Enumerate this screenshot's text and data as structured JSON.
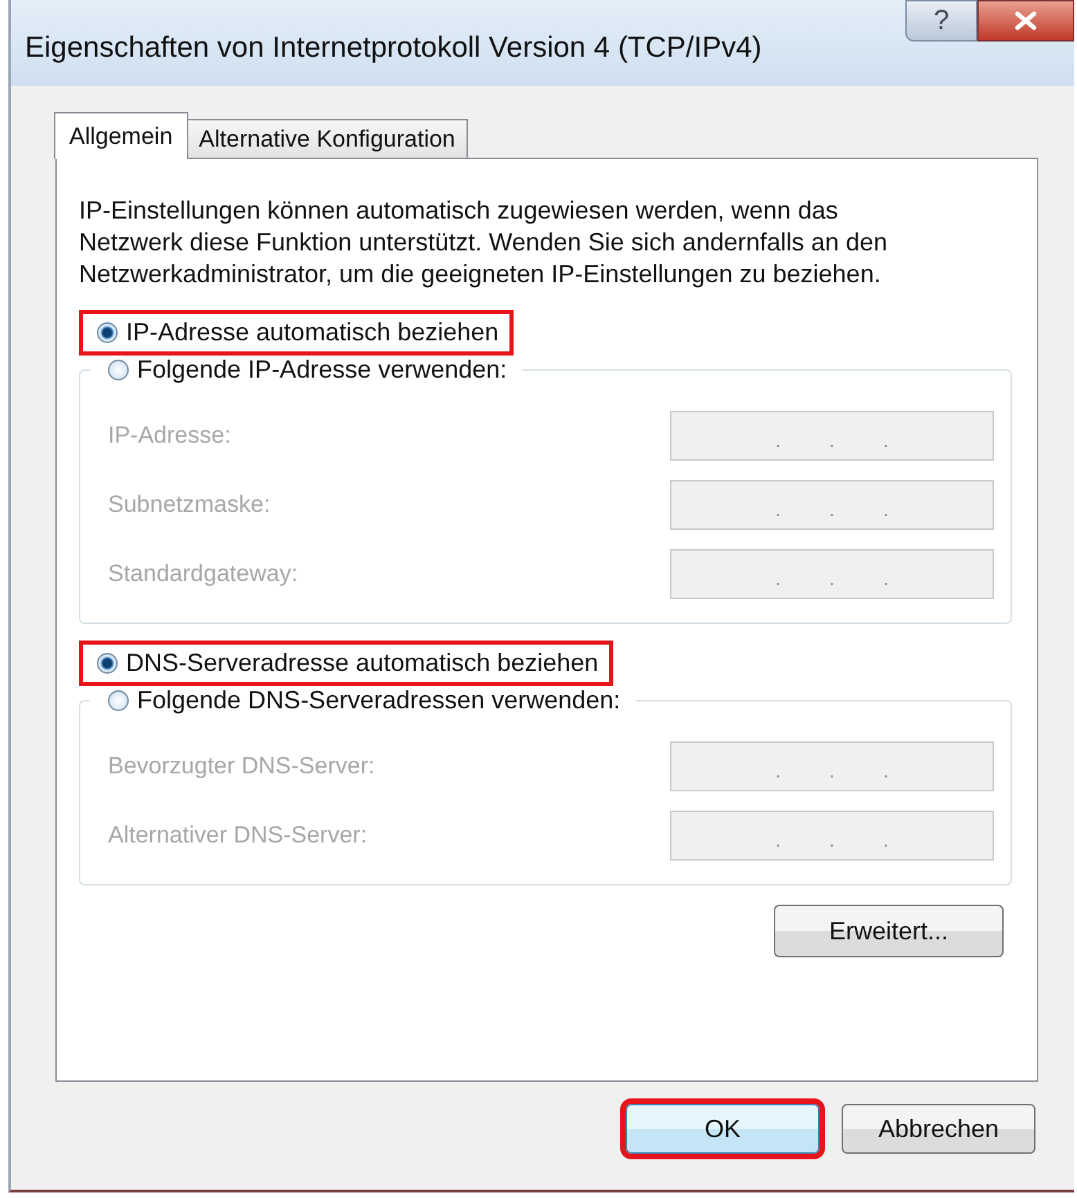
{
  "window": {
    "title": "Eigenschaften von Internetprotokoll Version 4 (TCP/IPv4)",
    "help_label": "?"
  },
  "tabs": [
    {
      "label": "Allgemein",
      "selected": true
    },
    {
      "label": "Alternative Konfiguration",
      "selected": false
    }
  ],
  "description": "IP-Einstellungen können automatisch zugewiesen werden, wenn das Netzwerk diese Funktion unterstützt. Wenden Sie sich andernfalls an den Netzwerkadministrator, um die geeigneten IP-Einstellungen zu beziehen.",
  "groups": [
    {
      "auto_option": {
        "label": "IP-Adresse automatisch beziehen",
        "selected": true,
        "highlighted": true
      },
      "manual_option": {
        "label": "Folgende IP-Adresse verwenden:",
        "selected": false,
        "highlighted": false
      },
      "fields": [
        {
          "label": "IP-Adresse:",
          "disabled": true,
          "separators": [
            ".",
            ".",
            "."
          ]
        },
        {
          "label": "Subnetzmaske:",
          "disabled": true,
          "separators": [
            ".",
            ".",
            "."
          ]
        },
        {
          "label": "Standardgateway:",
          "disabled": true,
          "separators": [
            ".",
            ".",
            "."
          ]
        }
      ]
    },
    {
      "auto_option": {
        "label": "DNS-Serveradresse automatisch beziehen",
        "selected": true,
        "highlighted": true
      },
      "manual_option": {
        "label": "Folgende DNS-Serveradressen verwenden:",
        "selected": false,
        "highlighted": false
      },
      "fields": [
        {
          "label": "Bevorzugter DNS-Server:",
          "disabled": true,
          "separators": [
            ".",
            ".",
            "."
          ]
        },
        {
          "label": "Alternativer DNS-Server:",
          "disabled": true,
          "separators": [
            ".",
            ".",
            "."
          ]
        }
      ]
    }
  ],
  "advanced_button": {
    "label": "Erweitert..."
  },
  "buttons": [
    {
      "label": "OK",
      "highlighted": true
    },
    {
      "label": "Abbrechen",
      "highlighted": false
    }
  ]
}
